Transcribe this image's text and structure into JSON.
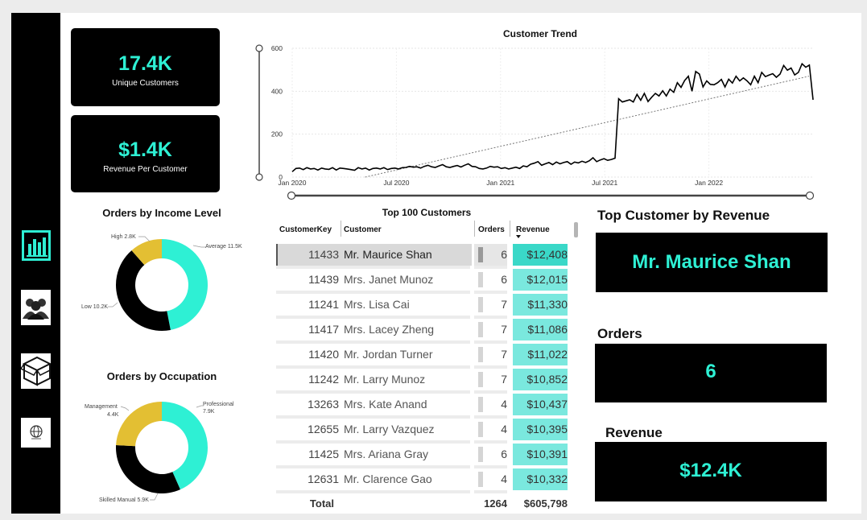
{
  "kpis": {
    "unique_customers": {
      "value": "17.4K",
      "label": "Unique Customers"
    },
    "revenue_per_customer": {
      "value": "$1.4K",
      "label": "Revenue Per Customer"
    }
  },
  "sidebar": {
    "items": [
      {
        "icon": "bar-chart-icon"
      },
      {
        "icon": "customers-icon"
      },
      {
        "icon": "product-box-icon"
      },
      {
        "icon": "globe-icon"
      }
    ]
  },
  "colors": {
    "accent": "#2ef0d4",
    "gold": "#e3bf33",
    "dark": "#000000"
  },
  "income_chart": {
    "title": "Orders by Income Level",
    "slices": [
      {
        "name": "Average",
        "label": "Average 11.5K",
        "value": 11.5,
        "color": "#2ef0d4"
      },
      {
        "name": "Low",
        "label": "Low 10.2K",
        "value": 10.2,
        "color": "#000000"
      },
      {
        "name": "High",
        "label": "High 2.8K",
        "value": 2.8,
        "color": "#e3bf33"
      }
    ]
  },
  "occupation_chart": {
    "title": "Orders by Occupation",
    "slices": [
      {
        "name": "Professional",
        "label1": "Professional",
        "label2": "7.9K",
        "value": 7.9,
        "color": "#2ef0d4"
      },
      {
        "name": "Skilled Manual",
        "label1": "Skilled Manual 5.9K",
        "label2": "",
        "value": 5.9,
        "color": "#000000"
      },
      {
        "name": "Management",
        "label1": "Management",
        "label2": "4.4K",
        "value": 4.4,
        "color": "#e3bf33"
      }
    ]
  },
  "chart_data": {
    "type": "line",
    "title": "Customer Trend",
    "xlabel": "",
    "ylabel": "",
    "ylim": [
      0,
      600
    ],
    "yticks": [
      "0",
      "200",
      "400",
      "600"
    ],
    "xticks": [
      "Jan 2020",
      "Jul 2020",
      "Jan 2021",
      "Jul 2021",
      "Jan 2022"
    ],
    "x_start": "Jan 2020",
    "x_end": "Jun 2022",
    "trendline": {
      "start": -15,
      "end": 470,
      "style": "dotted"
    },
    "series": [
      {
        "values": [
          25,
          40,
          42,
          35,
          44,
          38,
          40,
          33,
          42,
          38,
          36,
          44,
          33,
          42,
          40,
          38,
          35,
          32,
          44,
          38,
          42,
          33,
          40,
          42,
          38,
          44,
          35,
          40,
          42,
          38,
          44,
          45,
          50,
          46,
          48,
          42,
          50,
          55,
          48,
          45,
          52,
          58,
          48,
          45,
          50,
          54,
          47,
          55,
          62,
          50,
          48,
          40,
          38,
          42,
          50,
          46,
          48,
          40,
          44,
          38,
          42,
          46,
          40,
          52,
          48,
          60,
          65,
          72,
          55,
          62,
          68,
          58,
          70,
          62,
          68,
          72,
          60,
          70,
          66,
          74,
          68,
          76,
          90,
          72,
          80,
          86,
          78,
          82,
          88,
          365,
          350,
          355,
          360,
          350,
          385,
          358,
          390,
          352,
          372,
          390,
          378,
          402,
          378,
          410,
          395,
          440,
          418,
          450,
          470,
          400,
          492,
          480,
          420,
          448,
          432,
          430,
          440,
          455,
          420,
          456,
          438,
          470,
          448,
          462,
          448,
          430,
          470,
          440,
          488,
          468,
          475,
          482,
          465,
          480,
          520,
          498,
          508,
          476,
          488,
          528,
          512,
          522,
          360
        ]
      }
    ]
  },
  "table": {
    "title": "Top 100 Customers",
    "columns": [
      "CustomerKey",
      "Customer",
      "Orders",
      "Revenue"
    ],
    "rows": [
      {
        "key": "11433",
        "customer": "Mr. Maurice Shan",
        "orders": "6",
        "revenue": "$12,408"
      },
      {
        "key": "11439",
        "customer": "Mrs. Janet Munoz",
        "orders": "6",
        "revenue": "$12,015"
      },
      {
        "key": "11241",
        "customer": "Mrs. Lisa Cai",
        "orders": "7",
        "revenue": "$11,330"
      },
      {
        "key": "11417",
        "customer": "Mrs. Lacey Zheng",
        "orders": "7",
        "revenue": "$11,086"
      },
      {
        "key": "11420",
        "customer": "Mr. Jordan Turner",
        "orders": "7",
        "revenue": "$11,022"
      },
      {
        "key": "11242",
        "customer": "Mr. Larry Munoz",
        "orders": "7",
        "revenue": "$10,852"
      },
      {
        "key": "13263",
        "customer": "Mrs. Kate Anand",
        "orders": "4",
        "revenue": "$10,437"
      },
      {
        "key": "12655",
        "customer": "Mr. Larry Vazquez",
        "orders": "4",
        "revenue": "$10,395"
      },
      {
        "key": "11425",
        "customer": "Mrs. Ariana Gray",
        "orders": "6",
        "revenue": "$10,391"
      },
      {
        "key": "12631",
        "customer": "Mr. Clarence Gao",
        "orders": "4",
        "revenue": "$10,332"
      }
    ],
    "total": {
      "label": "Total",
      "orders": "1264",
      "revenue": "$605,798"
    }
  },
  "top_customer": {
    "title": "Top Customer by Revenue",
    "name": "Mr. Maurice Shan",
    "orders_title": "Orders",
    "orders": "6",
    "revenue_title": "Revenue",
    "revenue": "$12.4K"
  }
}
